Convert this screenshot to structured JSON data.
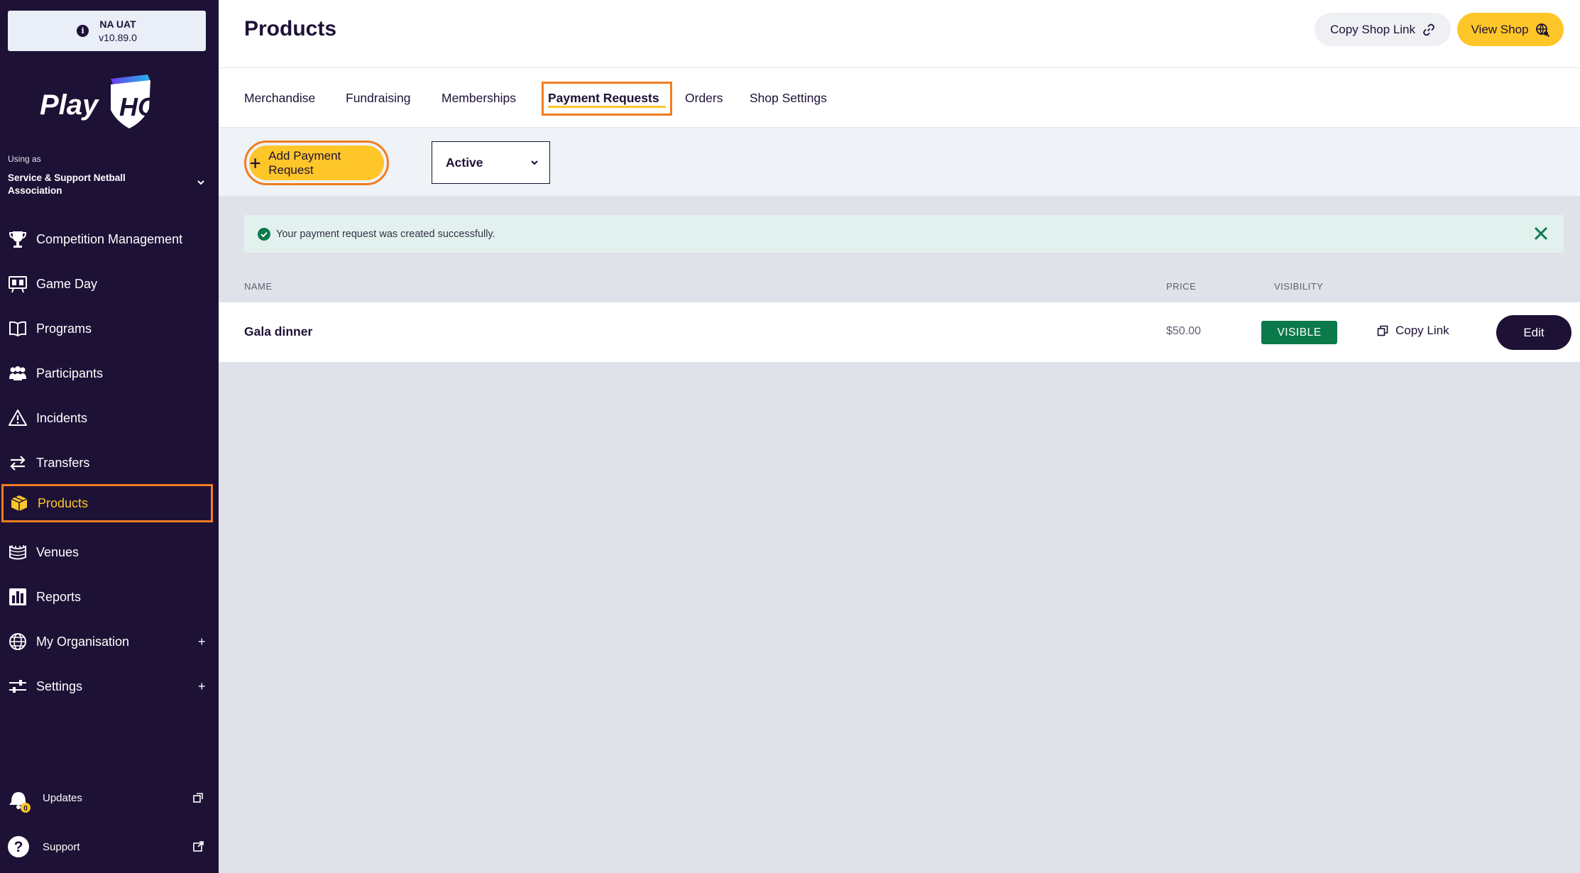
{
  "env": {
    "name": "NA UAT",
    "version": "v10.89.0",
    "info_icon": "i"
  },
  "brand": {
    "logo_text": "Play",
    "logo_mark": "HQ"
  },
  "org": {
    "using_as_label": "Using as",
    "name": "Service & Support Netball Association"
  },
  "nav": [
    {
      "label": "Competition Management",
      "icon": "trophy-icon"
    },
    {
      "label": "Game Day",
      "icon": "scoreboard-icon"
    },
    {
      "label": "Programs",
      "icon": "book-icon"
    },
    {
      "label": "Participants",
      "icon": "people-icon"
    },
    {
      "label": "Incidents",
      "icon": "warning-icon"
    },
    {
      "label": "Transfers",
      "icon": "transfer-arrows-icon"
    },
    {
      "label": "Products",
      "icon": "box-icon",
      "active": true
    },
    {
      "label": "Venues",
      "icon": "stadium-icon"
    },
    {
      "label": "Reports",
      "icon": "report-icon"
    },
    {
      "label": "My Organisation",
      "icon": "globe-icon",
      "expand": "+"
    },
    {
      "label": "Settings",
      "icon": "sliders-icon",
      "expand": "+"
    }
  ],
  "bottom_nav": {
    "updates": {
      "label": "Updates",
      "badge": "0"
    },
    "support": {
      "label": "Support"
    }
  },
  "header": {
    "title": "Products",
    "copy_shop_link": "Copy Shop Link",
    "view_shop": "View Shop"
  },
  "tabs": [
    "Merchandise",
    "Fundraising",
    "Memberships",
    "Payment Requests",
    "Orders",
    "Shop Settings"
  ],
  "active_tab": "Payment Requests",
  "toolbar": {
    "add_button": "Add Payment Request",
    "status_filter": "Active"
  },
  "alert": {
    "message": "Your payment request was created successfully."
  },
  "table": {
    "columns": {
      "name": "NAME",
      "price": "PRICE",
      "visibility": "VISIBILITY"
    },
    "rows": [
      {
        "name": "Gala dinner",
        "price": "$50.00",
        "visibility": "VISIBLE",
        "copy_link": "Copy Link",
        "edit": "Edit"
      }
    ]
  },
  "colors": {
    "sidebar": "#1d1136",
    "accent_yellow": "#ffc629",
    "highlight_orange": "#f07d22",
    "visible_green": "#0b7a4b"
  }
}
